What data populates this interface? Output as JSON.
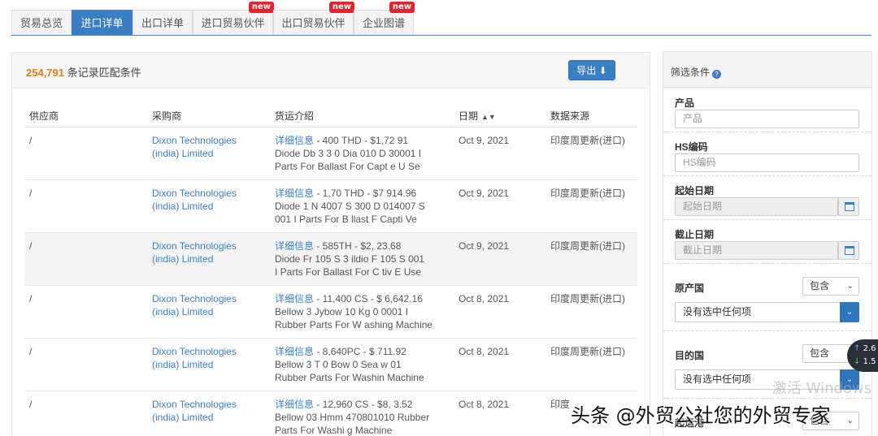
{
  "tabs": [
    {
      "label": "贸易总览",
      "active": false,
      "badge": ""
    },
    {
      "label": "进口详单",
      "active": true,
      "badge": ""
    },
    {
      "label": "出口详单",
      "active": false,
      "badge": ""
    },
    {
      "label": "进口贸易伙伴",
      "active": false,
      "badge": "new"
    },
    {
      "label": "出口贸易伙伴",
      "active": false,
      "badge": "new"
    },
    {
      "label": "企业图谱",
      "active": false,
      "badge": "new"
    }
  ],
  "results": {
    "count": "254,791",
    "count_suffix": "条记录匹配条件",
    "export_label": "导出"
  },
  "table": {
    "headers": [
      "供应商",
      "采购商",
      "货运介绍",
      "日期",
      "数据来源"
    ],
    "rows": [
      {
        "supplier": "/",
        "buyer_line1": "Dixon Technologies",
        "buyer_line2": "(india) Limited",
        "info": "详细信息",
        "desc1": " - 400 THD - $1,72  91",
        "desc2": "Diode Db 3 3  0 Dia 010 D  30001 I",
        "desc3": "Parts For Ballast For Capt  e U Se",
        "date": "Oct 9, 2021",
        "source": "印度周更新(进口)"
      },
      {
        "supplier": "/",
        "buyer_line1": "Dixon Technologies",
        "buyer_line2": "(india) Limited",
        "info": "详细信息",
        "desc1": " - 1,70  THD - $7  914.96",
        "desc2": "Diode 1 N 4007 S 300 D  014007 S",
        "desc3": "001 I Parts For B  llast F  Capti Ve",
        "date": "Oct 9, 2021",
        "source": "印度周更新(进口)"
      },
      {
        "supplier": "/",
        "buyer_line1": "Dixon Technologies",
        "buyer_line2": "(india) Limited",
        "info": "详细信息",
        "desc1": " - 585TH  - $2,  23.68",
        "desc2": "Diode Fr 105 S 3  ildio   F 105 S 001",
        "desc3": "I Parts For Ballast For C  tiv E Use",
        "date": "Oct 9, 2021",
        "source": "印度周更新(进口)"
      },
      {
        "supplier": "/",
        "buyer_line1": "Dixon Technologies",
        "buyer_line2": "(india) Limited",
        "info": "详细信息",
        "desc1": " - 11,400  CS - $  6,642.16",
        "desc2": "Bellow 3 Jybow 10 Kg 0  0001 I",
        "desc3": "Rubber Parts For W  ashing Machine",
        "date": "Oct 8, 2021",
        "source": "印度周更新(进口)"
      },
      {
        "supplier": "/",
        "buyer_line1": "Dixon Technologies",
        "buyer_line2": "(india) Limited",
        "info": "详细信息",
        "desc1": " - 8,640PC  - $  711.92",
        "desc2": "Bellow 3 T 0 Bow 0  Sea  w 01",
        "desc3": "Rubber Parts For  Washin  Machine",
        "date": "Oct 8, 2021",
        "source": "印度周更新(进口)"
      },
      {
        "supplier": "/",
        "buyer_line1": "Dixon Technologies",
        "buyer_line2": "(india) Limited",
        "info": "详细信息",
        "desc1": " - 12,960  CS - $8,  3.52",
        "desc2": "Bellow 03 Hmm  470801010 Rubber",
        "desc3": "Parts For Washi  g Machine",
        "date": "Oct 8, 2021",
        "source": "印度"
      }
    ]
  },
  "filter": {
    "title": "筛选条件",
    "product_label": "产品",
    "product_placeholder": "产品",
    "hs_label": "HS编码",
    "hs_placeholder": "HS编码",
    "start_label": "起始日期",
    "start_placeholder": "起始日期",
    "end_label": "截止日期",
    "end_placeholder": "截止日期",
    "origin_label": "原产国",
    "origin_mode": "包含",
    "origin_value": "没有选中任何项",
    "dest_label": "目的国",
    "dest_mode": "包含",
    "dest_value": "没有选中任何项",
    "extra_label": "起运港",
    "extra_mode": "包含"
  },
  "speed": {
    "up": "2.6",
    "down": "1.5"
  },
  "watermarks": {
    "windows": "激活 Windows",
    "toutiao": "头条 @外贸公社您的外贸专家"
  },
  "colors": {
    "accent": "#3a7fc4",
    "count": "#e07b1a",
    "badge": "#e8222c"
  }
}
